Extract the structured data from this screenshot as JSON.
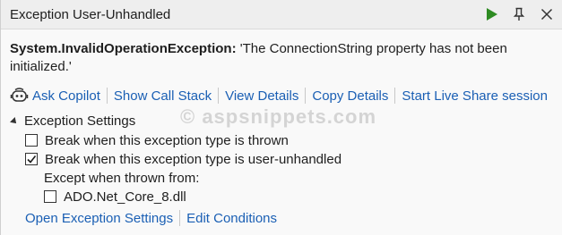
{
  "window": {
    "title": "Exception User-Unhandled"
  },
  "exception": {
    "name": "System.InvalidOperationException:",
    "message": "'The ConnectionString property has not been initialized.'"
  },
  "actions": {
    "ask_copilot": "Ask Copilot",
    "show_call_stack": "Show Call Stack",
    "view_details": "View Details",
    "copy_details": "Copy Details",
    "live_share": "Start Live Share session"
  },
  "watermark": "© aspsnippets.com",
  "settings": {
    "heading": "Exception Settings",
    "break_thrown": {
      "label": "Break when this exception type is thrown",
      "checked": false
    },
    "break_unhandled": {
      "label": "Break when this exception type is user-unhandled",
      "checked": true
    },
    "except_label": "Except when thrown from:",
    "module": {
      "label": "ADO.Net_Core_8.dll",
      "checked": false
    }
  },
  "footer": {
    "open_settings": "Open Exception Settings",
    "edit_conditions": "Edit Conditions"
  },
  "colors": {
    "link": "#1a5fb4",
    "run_green": "#2e8b22",
    "background": "#f9f9f9"
  },
  "icons": [
    "play-icon",
    "pin-icon",
    "close-icon",
    "copilot-icon",
    "checkmark-icon",
    "expand-triangle-icon"
  ]
}
